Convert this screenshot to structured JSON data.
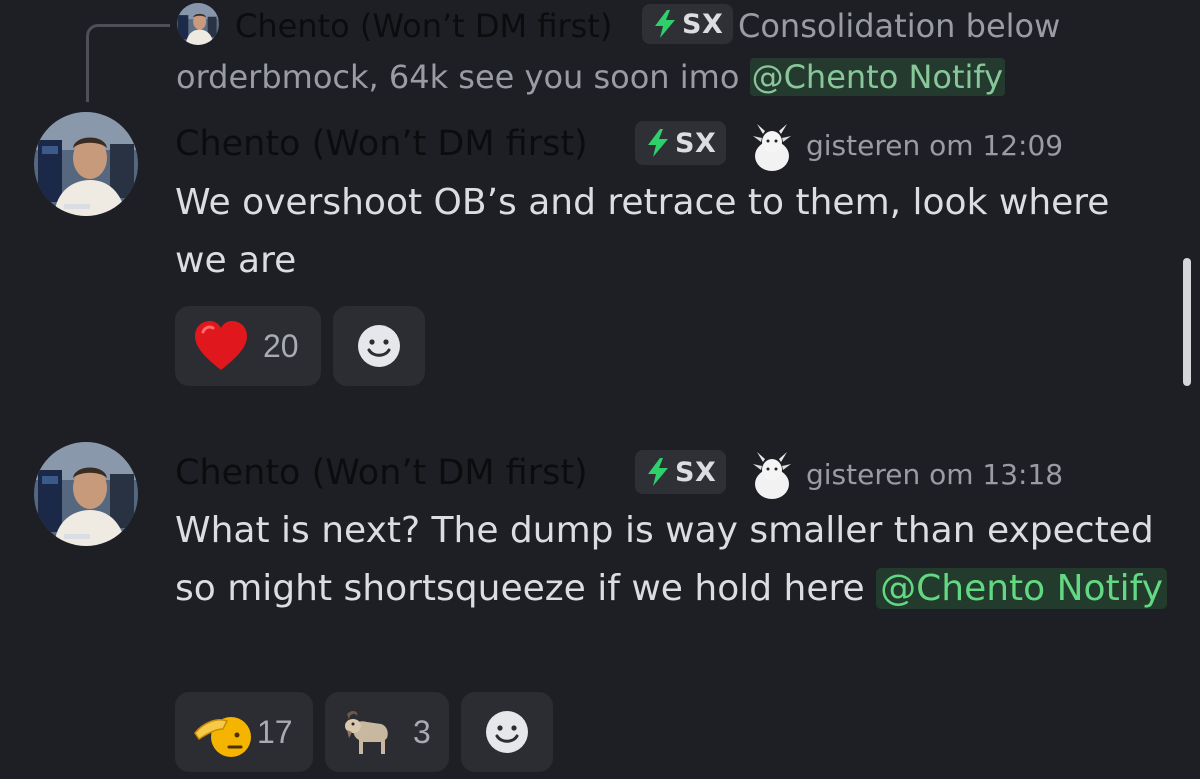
{
  "reply_preview": {
    "author": "Chento (Won’t DM first)",
    "tag": "SX",
    "text_line1": "Consolidation below",
    "text_line2": "orderbmock, 64k see you soon imo ",
    "mention": "@Chento Notify"
  },
  "messages": [
    {
      "author": "Chento (Won’t DM first)",
      "tag": "SX",
      "timestamp": "gisteren om 12:09",
      "text": "We overshoot OB’s and retrace to them, look where we are",
      "reactions": [
        {
          "emoji": "heart-emoji",
          "count": "20"
        }
      ]
    },
    {
      "author": "Chento (Won’t DM first)",
      "tag": "SX",
      "timestamp": "gisteren om 13:18",
      "text": "What is next? The dump is way smaller than expected so might shortsqueeze if we hold here ",
      "mention": "@Chento Notify",
      "reactions": [
        {
          "emoji": "saluting-face-emoji",
          "count": "17"
        },
        {
          "emoji": "goat-emoji",
          "count": "3"
        }
      ]
    }
  ],
  "colors": {
    "background": "#1e1f24",
    "mention_text": "#5dd37c",
    "mention_bg": "#233a2e",
    "reaction_bg": "#2b2d32",
    "timestamp": "#9a9ca4"
  }
}
